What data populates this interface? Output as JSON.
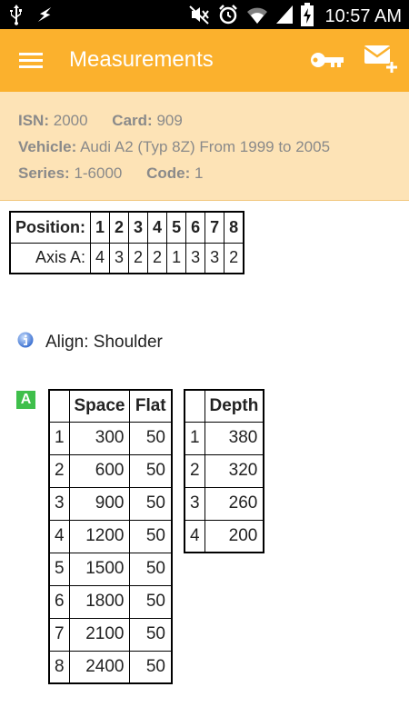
{
  "status_bar": {
    "time": "10:57 AM",
    "icons": [
      "usb-icon",
      "flash-icon",
      "mute-icon",
      "alarm-icon",
      "wifi-icon",
      "signal-icon",
      "battery-charging-icon"
    ]
  },
  "app_bar": {
    "title": "Measurements",
    "icons": [
      "menu-icon",
      "key-icon",
      "add-mail-icon"
    ]
  },
  "info": {
    "isn_label": "ISN:",
    "isn_value": "2000",
    "card_label": "Card:",
    "card_value": "909",
    "vehicle_label": "Vehicle:",
    "vehicle_value": "Audi A2 (Typ 8Z) From 1999 to 2005",
    "series_label": "Series:",
    "series_value": "1-6000",
    "code_label": "Code:",
    "code_value": "1"
  },
  "position_table": {
    "header_label": "Position:",
    "positions": [
      "1",
      "2",
      "3",
      "4",
      "5",
      "6",
      "7",
      "8"
    ],
    "row_label": "Axis A:",
    "values": [
      "4",
      "3",
      "2",
      "2",
      "1",
      "3",
      "3",
      "2"
    ]
  },
  "align": {
    "icon": "info-icon",
    "text": "Align: Shoulder"
  },
  "section_badge": "A",
  "space_table": {
    "headers": [
      "",
      "Space",
      "Flat"
    ],
    "rows": [
      [
        "1",
        "300",
        "50"
      ],
      [
        "2",
        "600",
        "50"
      ],
      [
        "3",
        "900",
        "50"
      ],
      [
        "4",
        "1200",
        "50"
      ],
      [
        "5",
        "1500",
        "50"
      ],
      [
        "6",
        "1800",
        "50"
      ],
      [
        "7",
        "2100",
        "50"
      ],
      [
        "8",
        "2400",
        "50"
      ]
    ]
  },
  "depth_table": {
    "headers": [
      "",
      "Depth"
    ],
    "rows": [
      [
        "1",
        "380"
      ],
      [
        "2",
        "320"
      ],
      [
        "3",
        "260"
      ],
      [
        "4",
        "200"
      ]
    ]
  },
  "colors": {
    "app_bar": "#fbb12d",
    "info_panel": "#fde3b6",
    "info_text": "#8a8a8a",
    "badge": "#3fbf4b"
  }
}
